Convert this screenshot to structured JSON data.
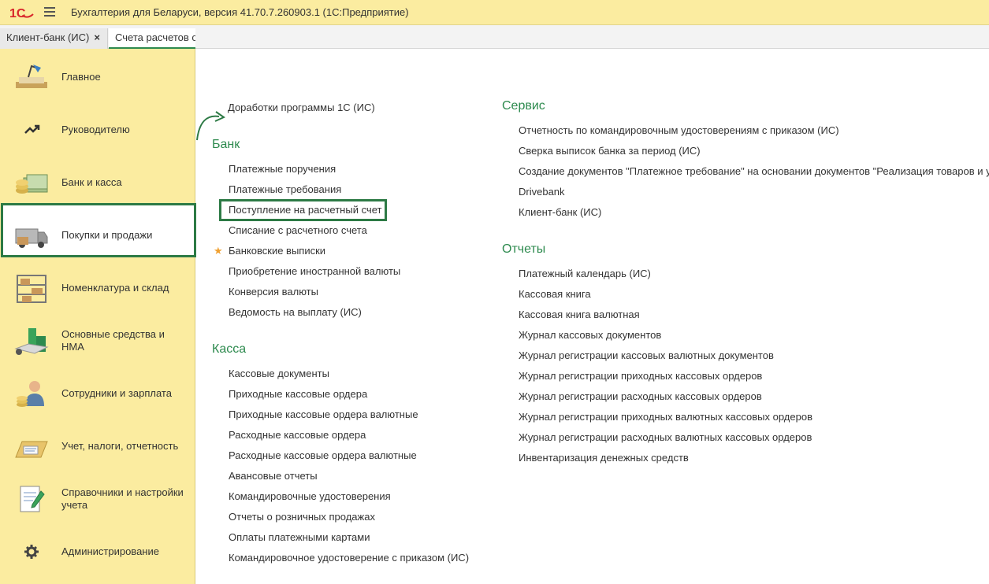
{
  "app": {
    "title": "Бухгалтерия для Беларуси, версия 41.70.7.260903.1  (1С:Предприятие)",
    "logo_text": "1С"
  },
  "tabs": [
    {
      "label": "Клиент-банк (ИС)",
      "close": "×"
    },
    {
      "label": "Счета расчетов с"
    }
  ],
  "sidebar": {
    "items": [
      {
        "label": "Главное"
      },
      {
        "label": "Руководителю"
      },
      {
        "label": "Банк и касса"
      },
      {
        "label": "Покупки и продажи"
      },
      {
        "label": "Номенклатура и склад"
      },
      {
        "label": "Основные средства и НМА"
      },
      {
        "label": "Сотрудники и зарплата"
      },
      {
        "label": "Учет, налоги, отчетность"
      },
      {
        "label": "Справочники и настройки учета"
      },
      {
        "label": "Администрирование"
      }
    ]
  },
  "main": {
    "top_link": "Доработки программы 1С (ИС)",
    "bank": {
      "title": "Банк",
      "items": [
        "Платежные поручения",
        "Платежные требования",
        "Поступление на расчетный счет",
        "Списание с расчетного счета",
        "Банковские выписки",
        "Приобретение иностранной валюты",
        "Конверсия валюты",
        "Ведомость на выплату (ИС)"
      ],
      "star": "★"
    },
    "kassa": {
      "title": "Касса",
      "items": [
        "Кассовые документы",
        "Приходные кассовые ордера",
        "Приходные кассовые ордера валютные",
        "Расходные кассовые ордера",
        "Расходные кассовые ордера валютные",
        "Авансовые отчеты",
        "Командировочные удостоверения",
        "Отчеты о розничных продажах",
        "Оплаты платежными картами",
        "Командировочное удостоверение с приказом (ИС)"
      ]
    },
    "service": {
      "title": "Сервис",
      "items": [
        "Отчетность по командировочным удостоверениям с приказом (ИС)",
        "Сверка выписок банка за период (ИС)",
        "Создание документов \"Платежное требование\" на основании документов \"Реализация товаров и ус",
        "Drivebank",
        "Клиент-банк (ИС)"
      ]
    },
    "reports": {
      "title": "Отчеты",
      "items": [
        "Платежный календарь (ИС)",
        "Кассовая книга",
        "Кассовая книга валютная",
        "Журнал кассовых документов",
        "Журнал регистрации кассовых валютных документов",
        "Журнал регистрации приходных кассовых ордеров",
        "Журнал регистрации расходных кассовых ордеров",
        "Журнал регистрации приходных валютных кассовых ордеров",
        "Журнал регистрации расходных валютных кассовых ордеров",
        "Инвентаризация денежных средств"
      ]
    }
  },
  "colors": {
    "accent": "#2d8a4e",
    "highlight_border": "#2d7a45",
    "sidebar_bg": "#fbeca0",
    "star": "#f0a030"
  }
}
